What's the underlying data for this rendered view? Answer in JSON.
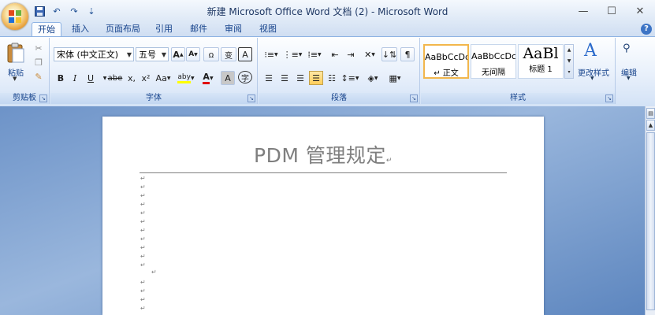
{
  "window": {
    "title": "新建 Microsoft Office Word 文档 (2) - Microsoft Word",
    "controls": {
      "minimize": "—",
      "maximize": "☐",
      "close": "✕"
    }
  },
  "quick_access": {
    "save_icon": "save-icon",
    "undo_glyph": "↶",
    "redo_glyph": "↷",
    "customize_glyph": "⇣"
  },
  "tabs": [
    {
      "label": "开始",
      "active": true
    },
    {
      "label": "插入"
    },
    {
      "label": "页面布局"
    },
    {
      "label": "引用"
    },
    {
      "label": "邮件"
    },
    {
      "label": "审阅"
    },
    {
      "label": "视图"
    }
  ],
  "clipboard": {
    "paste_label": "粘贴",
    "group_label": "剪贴板"
  },
  "font": {
    "font_name": "宋体 (中文正文)",
    "font_size": "五号",
    "grow": "A",
    "shrink": "A",
    "clear_format": "ꭥ",
    "phonetic": "变",
    "char_border": "A",
    "bold": "B",
    "italic": "I",
    "underline": "U",
    "strike": "abe",
    "subscript": "x,",
    "superscript": "x²",
    "change_case": "Aa",
    "highlight": "aby",
    "font_color": "A",
    "char_shading": "A",
    "enclose": "字",
    "group_label": "字体"
  },
  "paragraph": {
    "group_label": "段落"
  },
  "styles": {
    "items": [
      {
        "sample": "AaBbCcDd",
        "name": "↵ 正文",
        "active": true
      },
      {
        "sample": "AaBbCcDc",
        "name": "无间隔"
      },
      {
        "sample": "AaBl",
        "name": "标题 1"
      }
    ],
    "change_styles": "更改样式",
    "group_label": "样式"
  },
  "editing": {
    "label": "编辑"
  },
  "document": {
    "title": "PDM 管理规定",
    "return_mark": "↵"
  },
  "colors": {
    "highlight": "#ffff00",
    "font_color": "#e00000",
    "accent": "#15428b"
  }
}
